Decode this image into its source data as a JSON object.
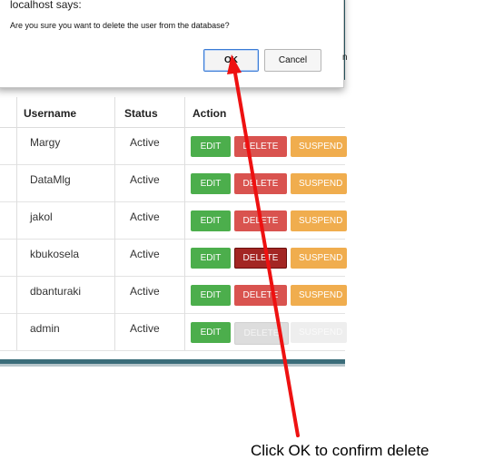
{
  "dialog": {
    "title": "localhost says:",
    "message": "Are you sure you want to delete the user from the database?",
    "ok_label": "OK",
    "cancel_label": "Cancel",
    "edge_letter": "n"
  },
  "table": {
    "headers": {
      "username": "Username",
      "status": "Status",
      "action": "Action"
    },
    "rows": [
      {
        "username": "Margy",
        "status": "Active",
        "edit": "EDIT",
        "delete": "DELETE",
        "suspend": "SUSPEND"
      },
      {
        "username": "DataMlg",
        "status": "Active",
        "edit": "EDIT",
        "delete": "DELETE",
        "suspend": "SUSPEND"
      },
      {
        "username": "jakol",
        "status": "Active",
        "edit": "EDIT",
        "delete": "DELETE",
        "suspend": "SUSPEND"
      },
      {
        "username": "kbukosela",
        "status": "Active",
        "edit": "EDIT",
        "delete": "DELETE",
        "suspend": "SUSPEND"
      },
      {
        "username": "dbanturaki",
        "status": "Active",
        "edit": "EDIT",
        "delete": "DELETE",
        "suspend": "SUSPEND"
      },
      {
        "username": "admin",
        "status": "Active",
        "edit": "EDIT",
        "delete": "DELETE",
        "suspend": "SUSPEND"
      }
    ]
  },
  "annotation": {
    "caption": "Click OK to confirm delete",
    "arrow_color": "#ee1111"
  }
}
